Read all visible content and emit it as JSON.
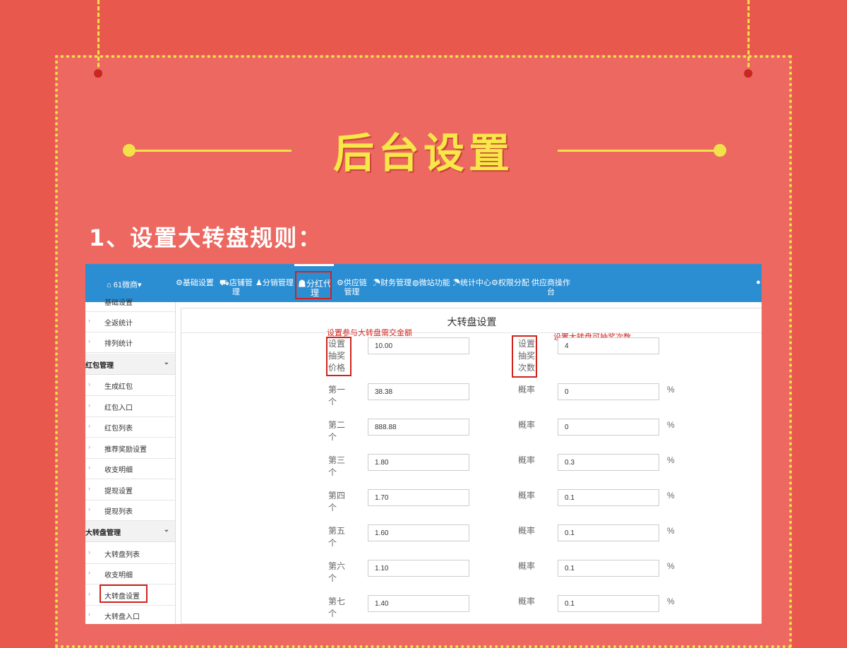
{
  "poster": {
    "main_title": "后台设置",
    "subtitle": "1、设置大转盘规则：",
    "colors": {
      "background": "#e8584c",
      "panel": "#ec6860",
      "accent": "#f2e24a",
      "highlight": "#d0231c",
      "nav": "#2b8ed3"
    }
  },
  "topnav": {
    "brand_icon": "home-icon",
    "brand": "61微商▾",
    "items": [
      {
        "icon": "gear-icon",
        "label": "基础设置"
      },
      {
        "icon": "truck-icon",
        "label": "店铺管",
        "label2": "理"
      },
      {
        "icon": "person-icon",
        "label": "分销管理"
      },
      {
        "icon": "users-icon",
        "label": "分红代",
        "label2": "理",
        "active": true
      },
      {
        "icon": "gears-icon",
        "label": "供应链",
        "label2": "管理"
      },
      {
        "icon": "umbrella-icon",
        "label": "财务管理"
      },
      {
        "icon": "globe-icon",
        "label": "微站功能"
      },
      {
        "icon": "umbrella-icon",
        "label": "统计中心"
      },
      {
        "icon": "gear-icon",
        "label": "权限分配"
      },
      {
        "icon": "",
        "label": "供应商操作",
        "label2": "台"
      }
    ],
    "user_icon": "user-icon"
  },
  "sidebar": {
    "top_item": "基础设置",
    "items": [
      "全返统计",
      "排列统计"
    ],
    "group1": "红包管理",
    "group1_items": [
      "生成红包",
      "红包入口",
      "红包列表",
      "推荐奖励设置",
      "收支明细",
      "提现设置",
      "提现列表"
    ],
    "group2": "大转盘管理",
    "group2_items": [
      "大转盘列表",
      "收支明细",
      "大转盘设置",
      "大转盘入口"
    ]
  },
  "form": {
    "title": "大转盘设置",
    "annot_price": "设置参与大转盘需交金额",
    "annot_count": "设置大转盘可抽奖次数",
    "price_label": [
      "设置",
      "抽奖",
      "价格"
    ],
    "price_value": "10.00",
    "count_label": [
      "设置",
      "抽奖",
      "次数"
    ],
    "count_value": "4",
    "prob_label": "概率",
    "pct": "%",
    "prizes": [
      {
        "label": [
          "第一",
          "个"
        ],
        "value": "38.38",
        "prob": "0"
      },
      {
        "label": [
          "第二",
          "个"
        ],
        "value": "888.88",
        "prob": "0"
      },
      {
        "label": [
          "第三",
          "个"
        ],
        "value": "1.80",
        "prob": "0.3"
      },
      {
        "label": [
          "第四",
          "个"
        ],
        "value": "1.70",
        "prob": "0.1"
      },
      {
        "label": [
          "第五",
          "个"
        ],
        "value": "1.60",
        "prob": "0.1"
      },
      {
        "label": [
          "第六",
          "个"
        ],
        "value": "1.10",
        "prob": "0.1"
      },
      {
        "label": [
          "第七",
          "个"
        ],
        "value": "1.40",
        "prob": "0.1"
      }
    ]
  }
}
